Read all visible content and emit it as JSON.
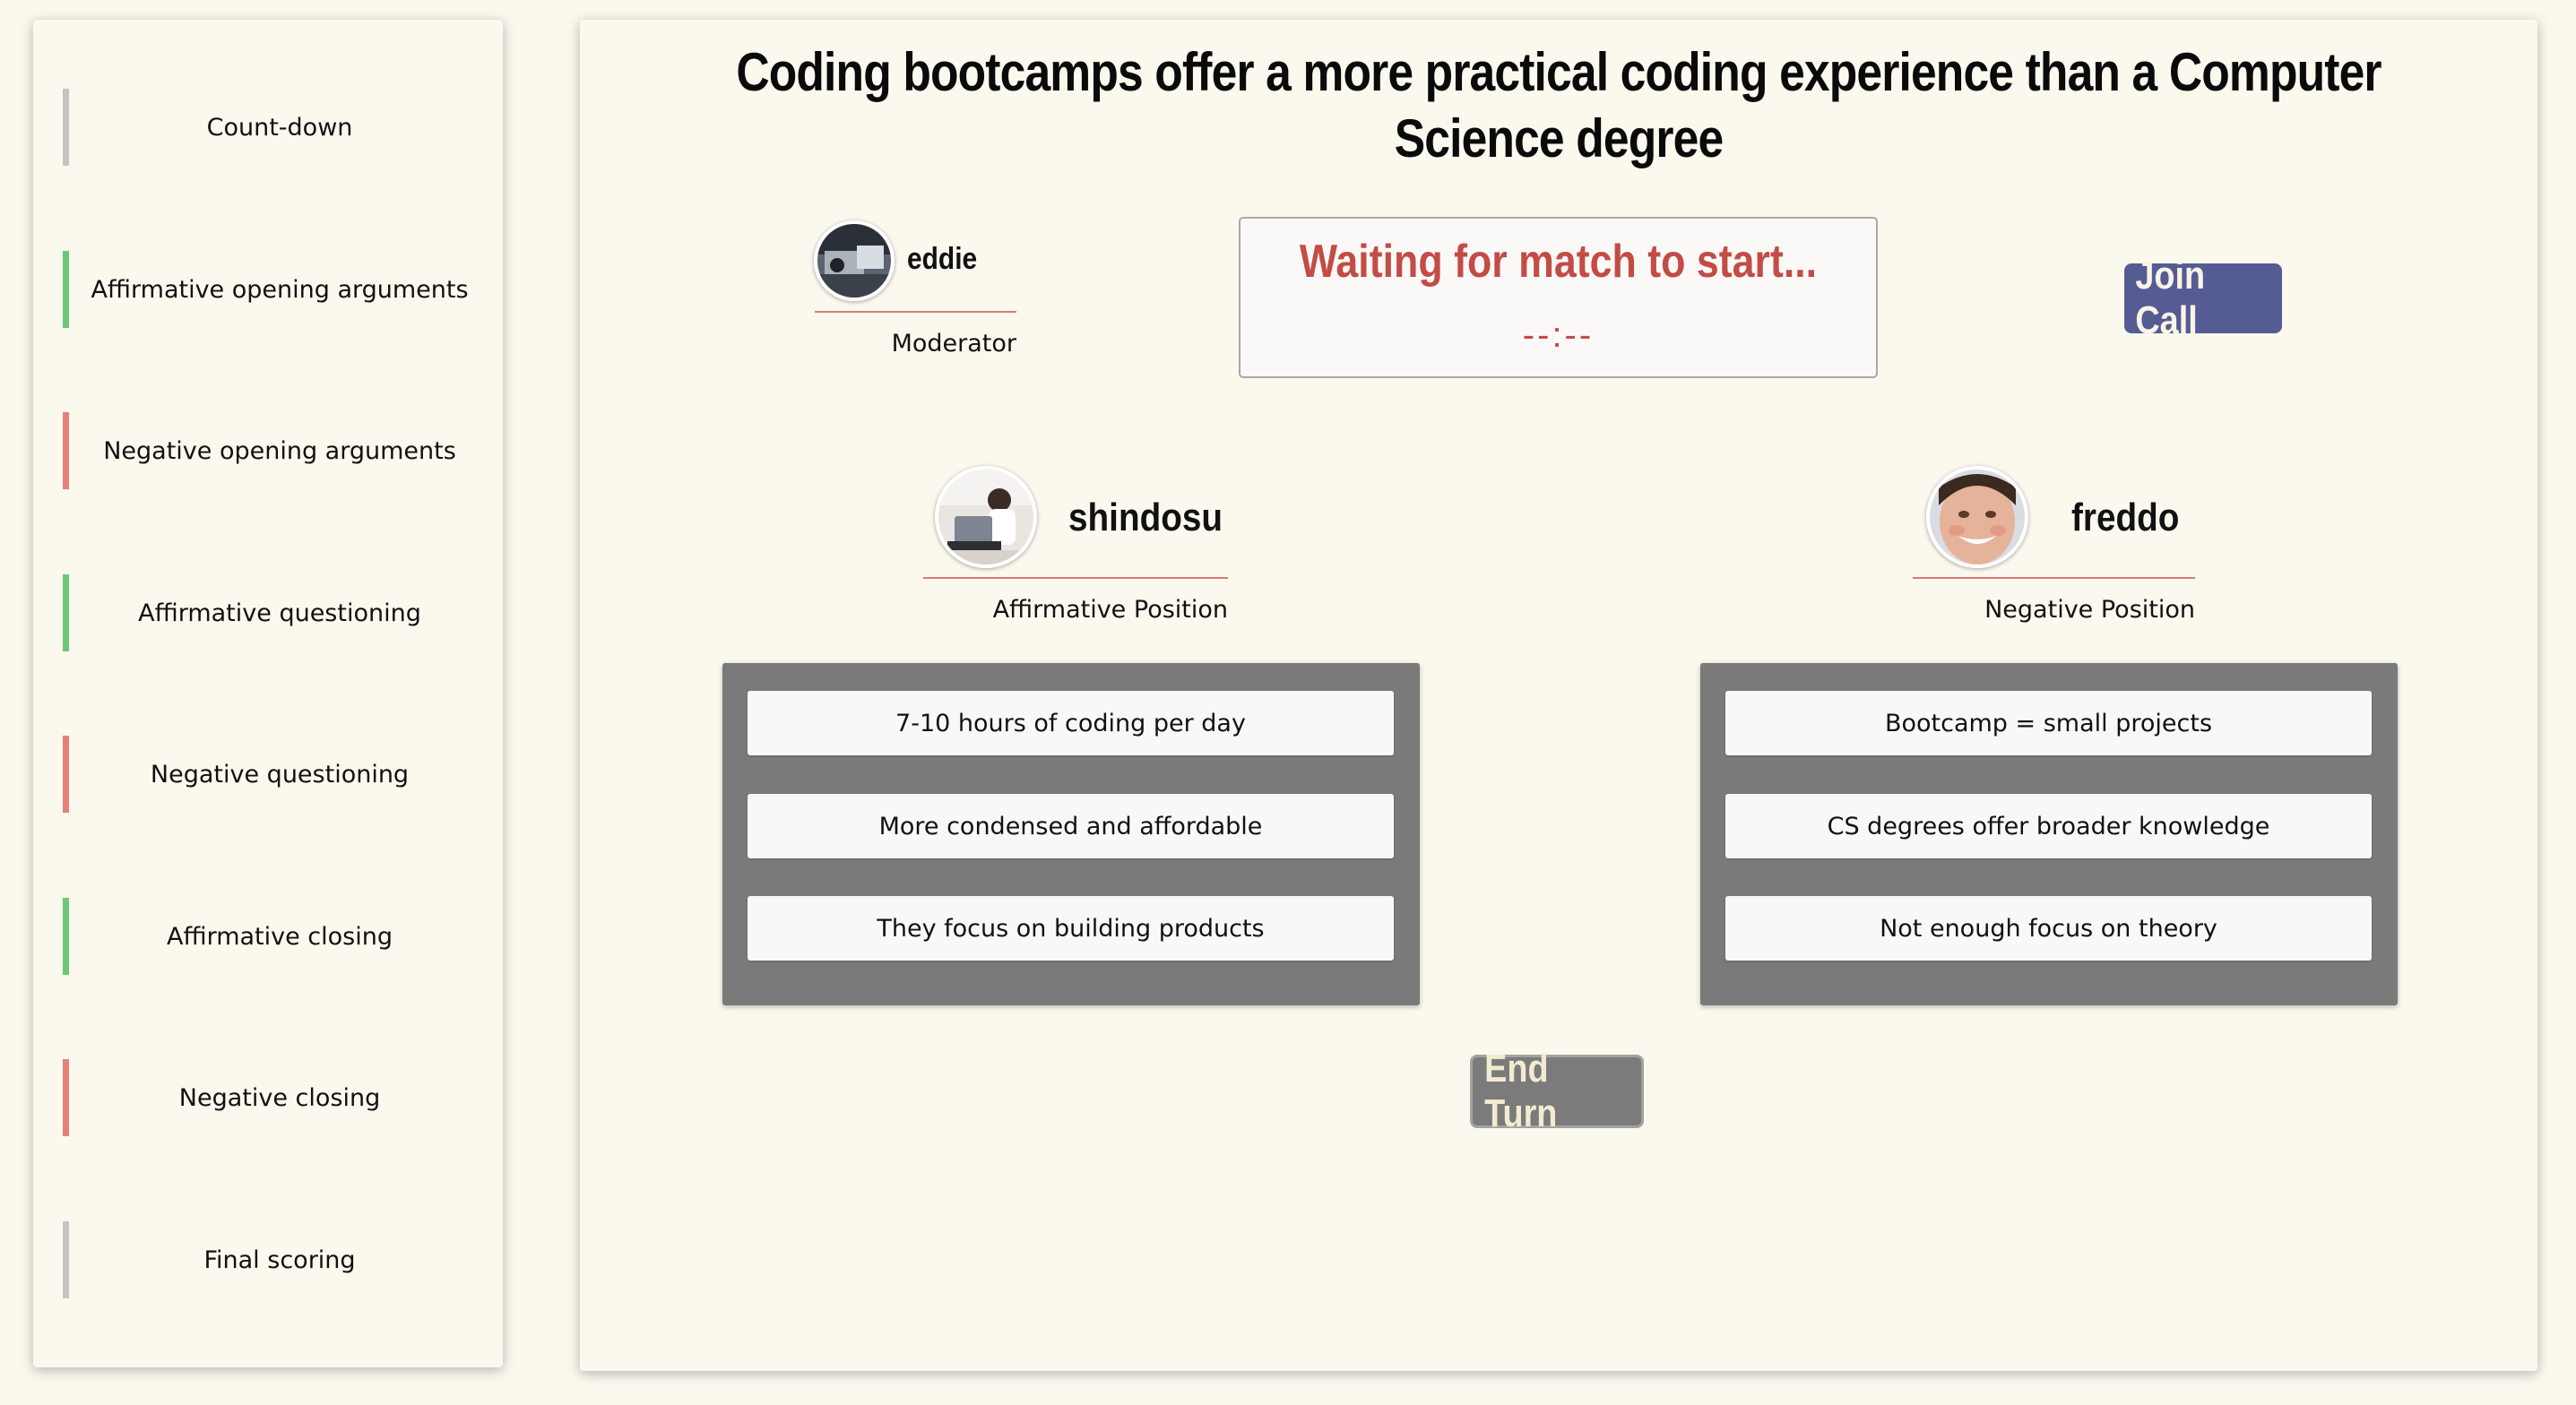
{
  "sidebar": {
    "phases": [
      {
        "label": "Count-down",
        "side": "neutral"
      },
      {
        "label": "Affirmative opening arguments",
        "side": "affirmative"
      },
      {
        "label": "Negative opening arguments",
        "side": "negative"
      },
      {
        "label": "Affirmative questioning",
        "side": "affirmative"
      },
      {
        "label": "Negative questioning",
        "side": "negative"
      },
      {
        "label": "Affirmative closing",
        "side": "affirmative"
      },
      {
        "label": "Negative closing",
        "side": "negative"
      },
      {
        "label": "Final scoring",
        "side": "neutral"
      }
    ]
  },
  "debate": {
    "title": "Coding bootcamps offer a more practical coding experience than a Computer Science degree"
  },
  "moderator": {
    "name": "eddie",
    "role": "Moderator"
  },
  "status": {
    "message": "Waiting for match to start...",
    "timer": "--:--"
  },
  "join_call_label": "Join Call",
  "affirmative": {
    "name": "shindosu",
    "role": "Affirmative Position",
    "arguments": [
      "7-10 hours of coding per day",
      "More condensed and affordable",
      "They focus on building products"
    ]
  },
  "negative": {
    "name": "freddo",
    "role": "Negative Position",
    "arguments": [
      "Bootcamp = small projects",
      "CS degrees offer broader knowledge",
      "Not enough focus on theory"
    ]
  },
  "end_turn_label": "End Turn",
  "colors": {
    "background": "#fbf8ee",
    "affirmative_accent": "#6cc779",
    "negative_accent": "#e8807a",
    "neutral_accent": "#c4c4c4",
    "status_red": "#c34c46",
    "join_button": "#555c94",
    "argument_panel": "#7a7a7a",
    "end_button": "#7b7b7b"
  }
}
